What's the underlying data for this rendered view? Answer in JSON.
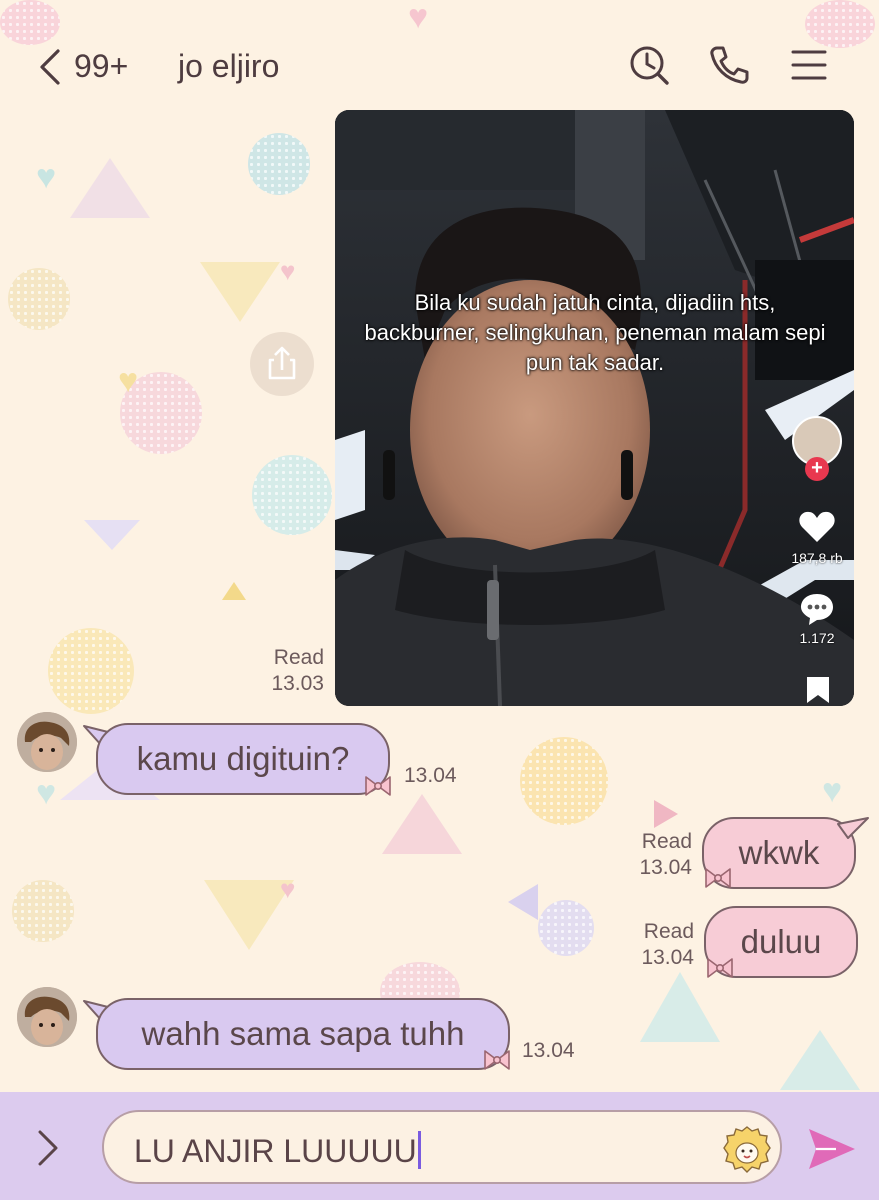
{
  "header": {
    "unread_count": "99+",
    "title": "jo eljiro"
  },
  "media_message": {
    "caption": "Bila ku sudah jatuh cinta, dijadiin hts, backburner, selingkuhan, peneman malam sepi pun tak sadar.",
    "like_count": "187,8 rb",
    "comment_count": "1.172",
    "read_status": "Read",
    "time": "13.03"
  },
  "messages": [
    {
      "direction": "in",
      "text": "kamu digituin?",
      "time": "13.04"
    },
    {
      "direction": "out",
      "text": "wkwk",
      "read_status": "Read",
      "time": "13.04"
    },
    {
      "direction": "out",
      "text": "duluu",
      "read_status": "Read",
      "time": "13.04"
    },
    {
      "direction": "in",
      "text": "wahh sama sapa tuhh",
      "time": "13.04"
    }
  ],
  "composer": {
    "value": "LU ANJIR LUUUUU"
  },
  "colors": {
    "background": "#fdf2e3",
    "incoming_bubble": "#d9c9f0",
    "outgoing_bubble": "#f7ccd6",
    "input_bar": "#dccbee",
    "send_accent": "#e06ab8"
  },
  "icons": [
    "back-icon",
    "clock-search-icon",
    "phone-icon",
    "menu-icon",
    "share-icon",
    "heart-icon",
    "comment-icon",
    "bookmark-icon",
    "bow-icon",
    "expand-icon",
    "sticker-icon",
    "send-icon"
  ]
}
